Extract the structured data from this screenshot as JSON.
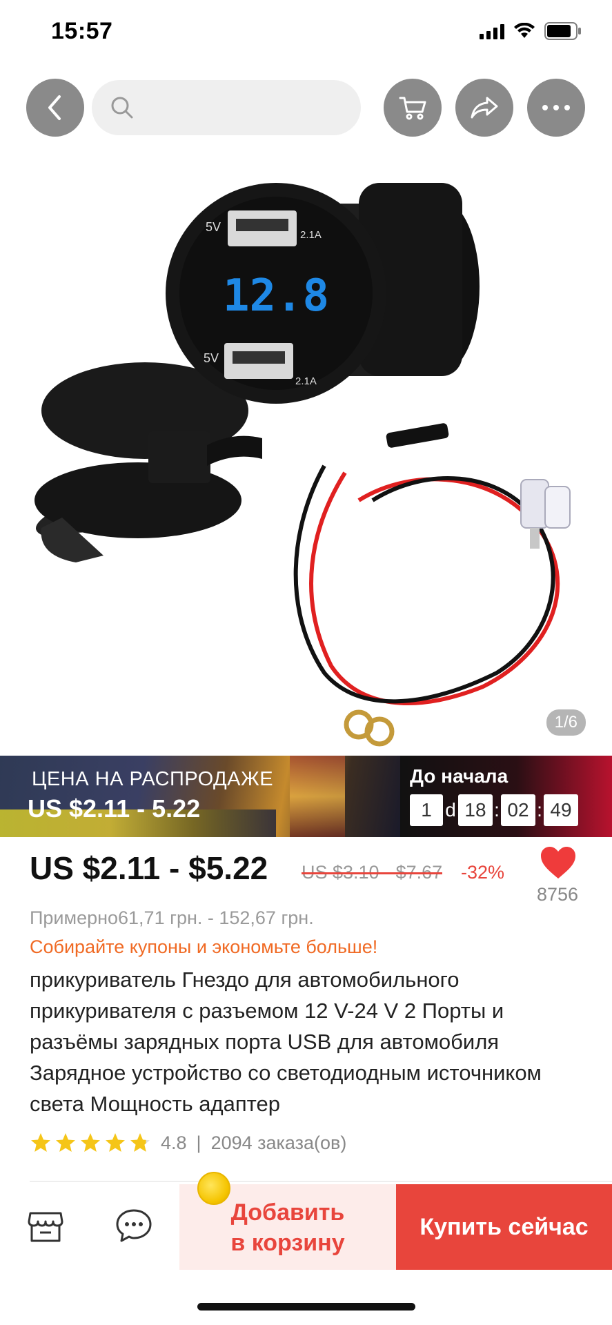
{
  "status_bar": {
    "time": "15:57"
  },
  "search": {
    "placeholder": ""
  },
  "image": {
    "counter": "1/6"
  },
  "sale": {
    "title": "ЦЕНА НА РАСПРОДАЖЕ",
    "price": "US $2.11 - 5.22",
    "countdown_label": "До начала",
    "days": "1",
    "days_unit": "d",
    "hours": "18",
    "minutes": "02",
    "seconds": "49"
  },
  "price": {
    "current": "US $2.11 - $5.22",
    "original": "US $3.10 - $7.67",
    "discount": "-32%",
    "likes": "8756",
    "approx": "Примерно61,71 грн. - 152,67 грн.",
    "coupon_text": "Собирайте купоны и экономьте больше!"
  },
  "product": {
    "title": "прикуриватель Гнездо для автомобильного прикуривателя с разъемом 12 V-24 V 2 Порты и разъёмы зарядных порта USB для автомобиля Зарядное устройство со светодиодным источником света Мощность адаптер",
    "rating": "4.8",
    "rating_separator": "|",
    "orders": "2094 заказа(ов)",
    "stars": 4.8
  },
  "bottom_bar": {
    "add_to_cart_line1": "Добавить",
    "add_to_cart_line2": "в корзину",
    "buy_now": "Купить сейчас"
  },
  "colors": {
    "accent": "#e8453c",
    "coupon": "#f06a24",
    "nav_button": "#8a8a8a"
  },
  "icons": [
    "back-arrow-icon",
    "search-icon",
    "cart-icon",
    "share-icon",
    "more-icon",
    "heart-icon",
    "star-icon",
    "store-icon",
    "chat-icon",
    "coin-icon"
  ]
}
